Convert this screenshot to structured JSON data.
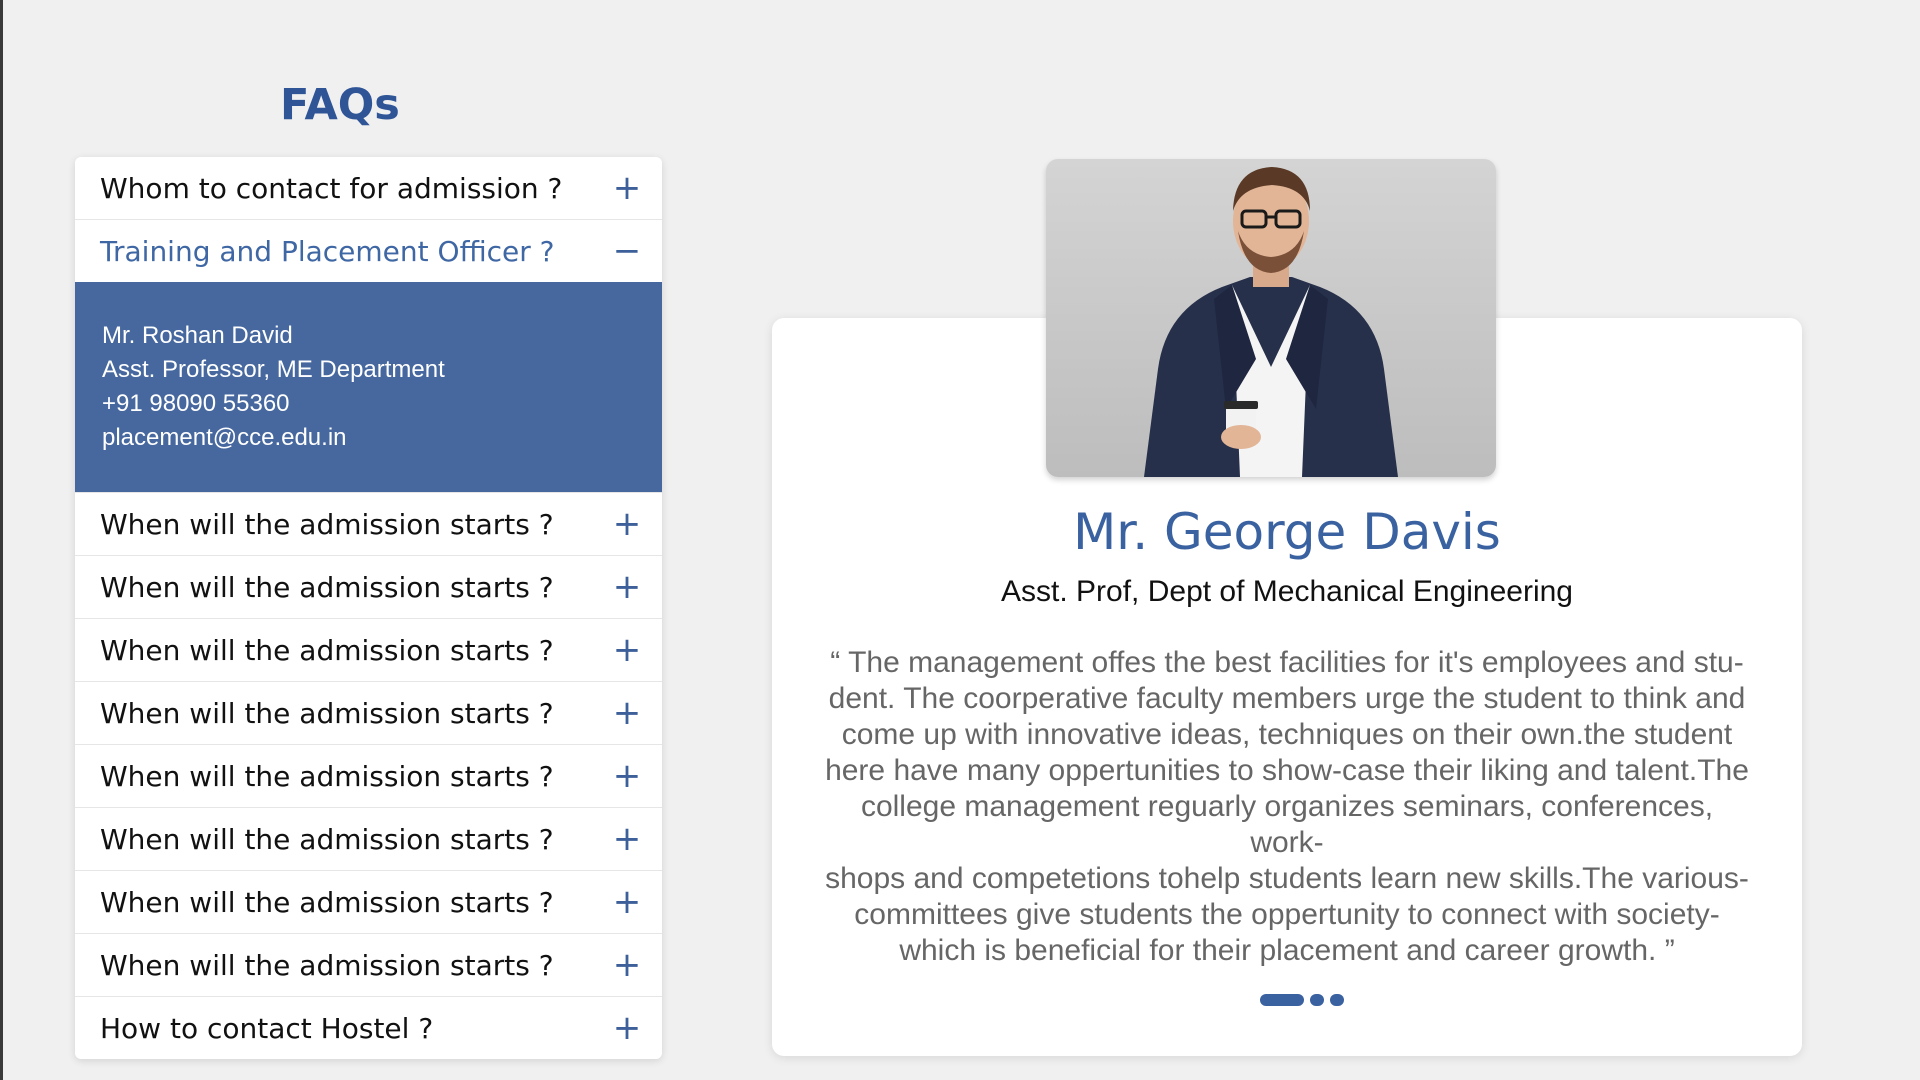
{
  "faq": {
    "title": "FAQs",
    "items": [
      {
        "question": "Whom to contact for admission ?",
        "toggle": "+",
        "open": false
      },
      {
        "question": "Training and Placement Officer ?",
        "toggle": "−",
        "open": true,
        "answer": [
          "Mr. Roshan David",
          "Asst. Professor, ME Department",
          "+91 98090 55360",
          "placement@cce.edu.in"
        ]
      },
      {
        "question": "When will the admission starts ?",
        "toggle": "+",
        "open": false
      },
      {
        "question": "When will the admission starts ?",
        "toggle": "+",
        "open": false
      },
      {
        "question": "When will the admission starts ?",
        "toggle": "+",
        "open": false
      },
      {
        "question": "When will the admission starts ?",
        "toggle": "+",
        "open": false
      },
      {
        "question": "When will the admission starts ?",
        "toggle": "+",
        "open": false
      },
      {
        "question": "When will the admission starts ?",
        "toggle": "+",
        "open": false
      },
      {
        "question": "When will the admission starts ?",
        "toggle": "+",
        "open": false
      },
      {
        "question": "When will the admission starts ?",
        "toggle": "+",
        "open": false
      },
      {
        "question": "How to contact Hostel ?",
        "toggle": "+",
        "open": false
      }
    ]
  },
  "testimonial": {
    "name": "Mr. George Davis",
    "role": "Asst. Prof, Dept of Mechanical Engineering",
    "quote_lines": [
      "“ The management offes the best facilities for it's employees and stu-",
      "dent. The coorperative faculty members urge the student to think and",
      "come up with innovative ideas, techniques on their own.the student",
      "here have many oppertunities to show-case their liking and talent.The",
      "college management reguarly organizes seminars, conferences, work-",
      "shops and competetions tohelp students learn new skills.The various-",
      "committees give students the oppertunity to connect with society-",
      "which is beneficial for their placement and career growth. ”"
    ],
    "photo_icon": "person-photo",
    "slides": 3,
    "active_slide": 0
  },
  "colors": {
    "accent": "#3a62a0",
    "answer_bg": "#46689f",
    "page_bg": "#f0f0f0"
  }
}
